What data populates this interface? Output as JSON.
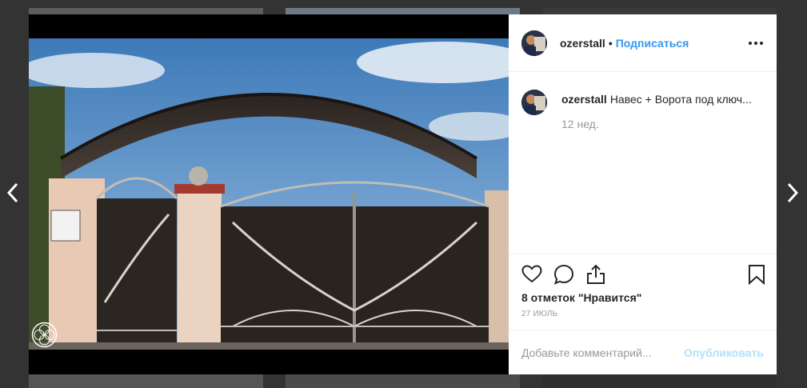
{
  "navigation": {
    "prev_icon": "chevron-left-icon",
    "next_icon": "chevron-right-icon"
  },
  "post": {
    "image_alt": "Wrought iron gate with arched canopy",
    "author": "ozerstall",
    "separator": "•",
    "follow_label": "Подписаться",
    "caption": "Навес + Ворота под ключ...",
    "caption_time": "12 нед.",
    "likes_text": "8 отметок \"Нравится\"",
    "date": "27 ИЮЛЬ"
  },
  "comment_box": {
    "placeholder": "Добавьте комментарий...",
    "publish_label": "Опубликовать"
  },
  "colors": {
    "link": "#3897f0",
    "publish_disabled": "#b2dffc",
    "muted": "#999999",
    "text": "#262626"
  },
  "icons": [
    "heart-icon",
    "comment-icon",
    "share-icon",
    "bookmark-icon",
    "more-options-icon"
  ]
}
